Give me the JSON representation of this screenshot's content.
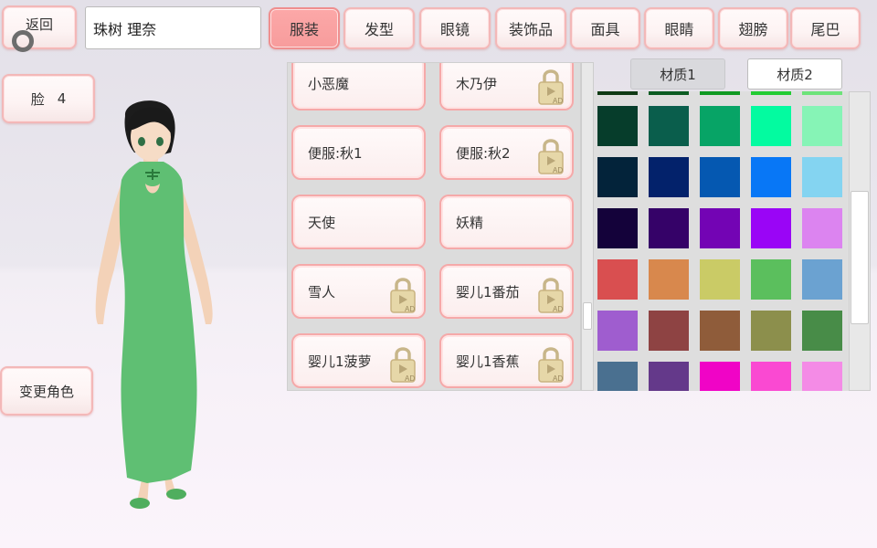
{
  "top": {
    "back_label": "返回",
    "player_name": "珠树 理奈",
    "tabs": [
      {
        "label": "服装",
        "active": true
      },
      {
        "label": "发型",
        "active": false
      },
      {
        "label": "眼镜",
        "active": false
      },
      {
        "label": "装饰品",
        "active": false
      },
      {
        "label": "面具",
        "active": false
      },
      {
        "label": "眼睛",
        "active": false
      },
      {
        "label": "翅膀",
        "active": false
      },
      {
        "label": "尾巴",
        "active": false
      }
    ]
  },
  "left": {
    "face_label": "脸",
    "face_value": "4",
    "change_character_label": "变更角色"
  },
  "clothing": {
    "items": [
      {
        "label": "小恶魔",
        "locked": false
      },
      {
        "label": "木乃伊",
        "locked": true
      },
      {
        "label": "便服:秋1",
        "locked": false
      },
      {
        "label": "便服:秋2",
        "locked": true
      },
      {
        "label": "天使",
        "locked": false
      },
      {
        "label": "妖精",
        "locked": false
      },
      {
        "label": "雪人",
        "locked": true
      },
      {
        "label": "婴儿1番茄",
        "locked": true
      },
      {
        "label": "婴儿1菠萝",
        "locked": true
      },
      {
        "label": "婴儿1香蕉",
        "locked": true
      }
    ],
    "ad_badge": "AD"
  },
  "material": {
    "tabs": [
      {
        "label": "材质1",
        "active": false
      },
      {
        "label": "材质2",
        "active": true
      }
    ],
    "swatch_rows": [
      [
        "#0f3a14",
        "#0c5c22",
        "#109a22",
        "#22cc33",
        "#6de37a"
      ],
      [
        "#063d2b",
        "#0a5e4c",
        "#07a466",
        "#03fba0",
        "#86f4b6"
      ],
      [
        "#03233a",
        "#03226b",
        "#0558b1",
        "#0877f6",
        "#84d4f1"
      ],
      [
        "#14023a",
        "#350268",
        "#7304b4",
        "#9a05f6",
        "#dc84f0"
      ],
      [
        "#d94f50",
        "#d8884d",
        "#cacb66",
        "#5bbf5d",
        "#6ba2d1"
      ],
      [
        "#9f5dcf",
        "#8e4343",
        "#8f5c3a",
        "#8c8f4c",
        "#488c48"
      ],
      [
        "#4a7090",
        "#64398a",
        "#f004c6",
        "#fa49d2",
        "#f48be6"
      ]
    ]
  },
  "colors": {
    "accent_tab": "#f79c9c",
    "button_border": "#f3b8b8",
    "dress_green": "#5fbf73"
  }
}
